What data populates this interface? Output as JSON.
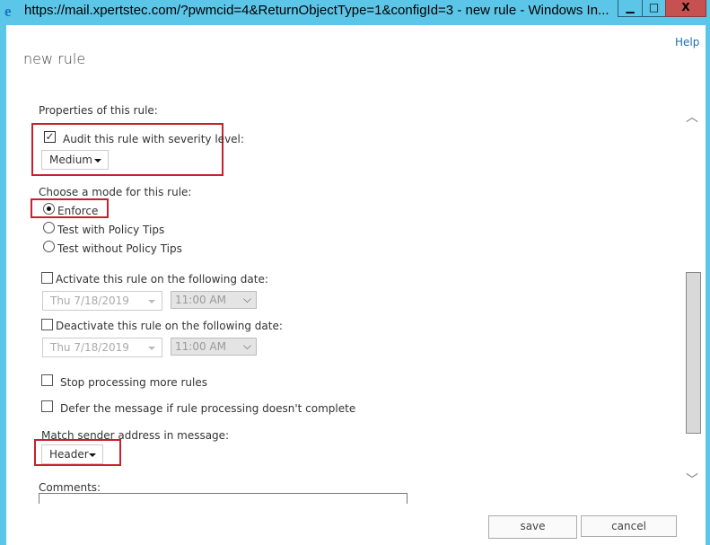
{
  "window": {
    "title": "https://mail.xpertstec.com/?pwmcid=4&ReturnObjectType=1&configId=3 - new rule - Windows In...",
    "minimize": "▁",
    "maximize": "□",
    "close": "X",
    "icon": "internet-explorer-icon"
  },
  "header": {
    "help": "Help",
    "title": "new rule"
  },
  "form": {
    "properties_label": "Properties of this rule:",
    "audit_label": "Audit this rule with severity level:",
    "audit_checked": true,
    "severity": "Medium",
    "mode_label": "Choose a mode for this rule:",
    "modes": [
      {
        "label": "Enforce",
        "selected": true
      },
      {
        "label": "Test with Policy Tips",
        "selected": false
      },
      {
        "label": "Test without Policy Tips",
        "selected": false
      }
    ],
    "activate_label": "Activate this rule on the following date:",
    "activate_date": "Thu 7/18/2019",
    "activate_time": "11:00 AM",
    "deactivate_label": "Deactivate this rule on the following date:",
    "deactivate_date": "Thu 7/18/2019",
    "deactivate_time": "11:00 AM",
    "stop_label": "Stop processing more rules",
    "defer_label": "Defer the message if rule processing doesn't complete",
    "match_label": "Match sender address in message:",
    "match_value": "Header",
    "comments_label": "Comments:"
  },
  "footer": {
    "save": "save",
    "cancel": "cancel"
  },
  "colors": {
    "frame": "#5cc6e8",
    "highlight": "#c8202e",
    "close": "#c75050"
  }
}
